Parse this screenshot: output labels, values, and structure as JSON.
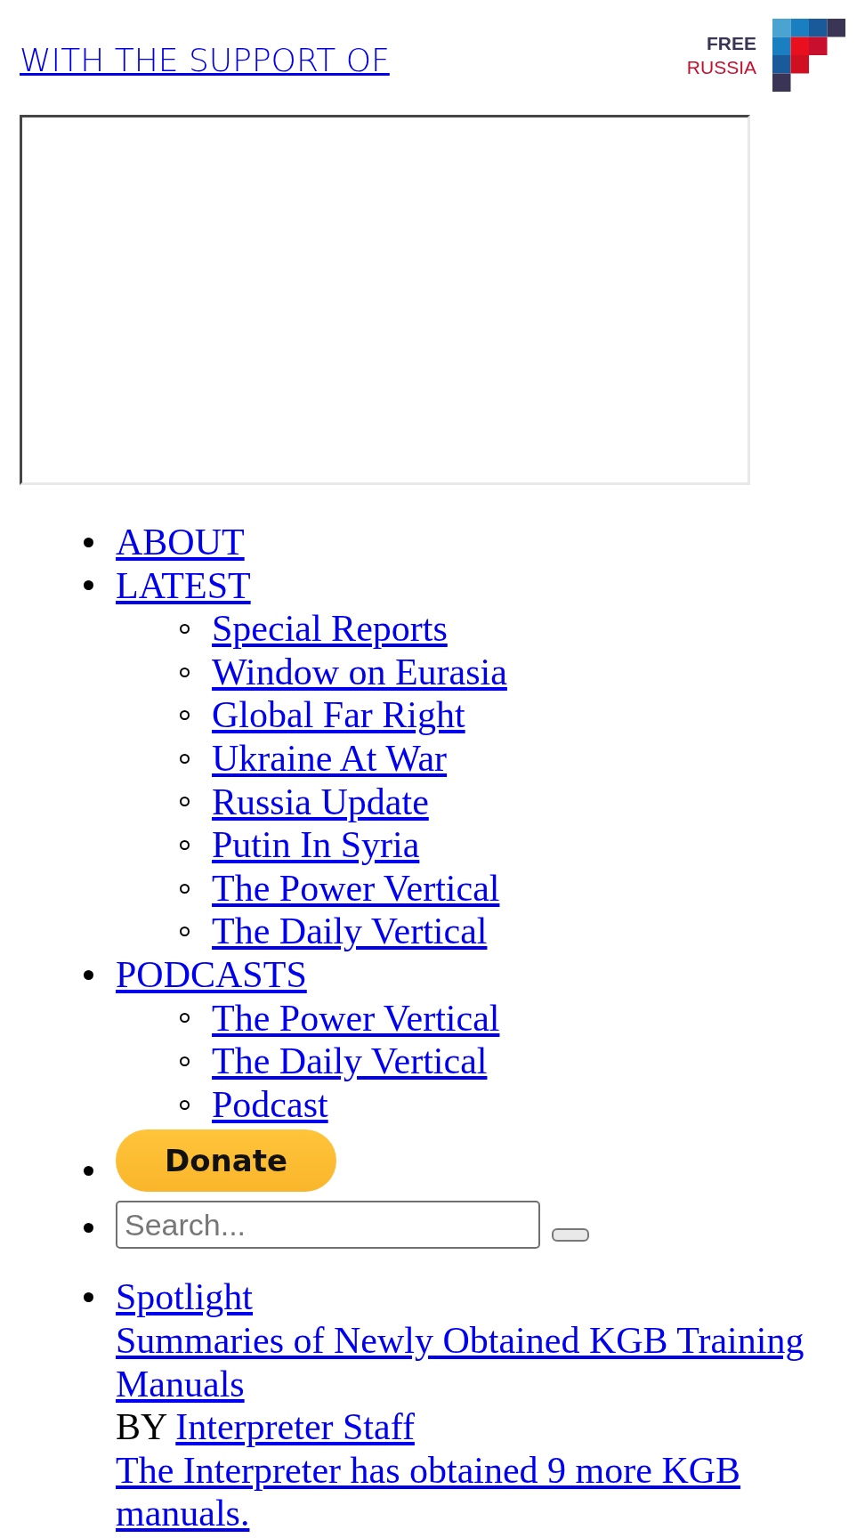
{
  "header": {
    "support_link": "WITH THE SUPPORT OF",
    "logo": {
      "line_1": "FREE",
      "line_2": "RUSSIA"
    }
  },
  "nav": [
    {
      "label": "ABOUT"
    },
    {
      "label": "LATEST",
      "children": [
        {
          "label": "Special Reports"
        },
        {
          "label": "Window on Eurasia"
        },
        {
          "label": "Global Far Right"
        },
        {
          "label": "Ukraine At War"
        },
        {
          "label": "Russia Update"
        },
        {
          "label": "Putin In Syria"
        },
        {
          "label": "The Power Vertical"
        },
        {
          "label": "The Daily Vertical"
        }
      ]
    },
    {
      "label": "PODCASTS",
      "children": [
        {
          "label": "The Power Vertical"
        },
        {
          "label": "The Daily Vertical"
        },
        {
          "label": "Podcast"
        }
      ]
    }
  ],
  "donate_button": {
    "label": "Donate"
  },
  "search": {
    "placeholder": "Search..."
  },
  "spotlight": {
    "label": "Spotlight",
    "title": "Summaries of Newly Obtained KGB Training Manuals",
    "byline_prefix": "BY",
    "author": "Interpreter Staff",
    "excerpt": "The Interpreter has obtained 9 more KGB manuals."
  }
}
